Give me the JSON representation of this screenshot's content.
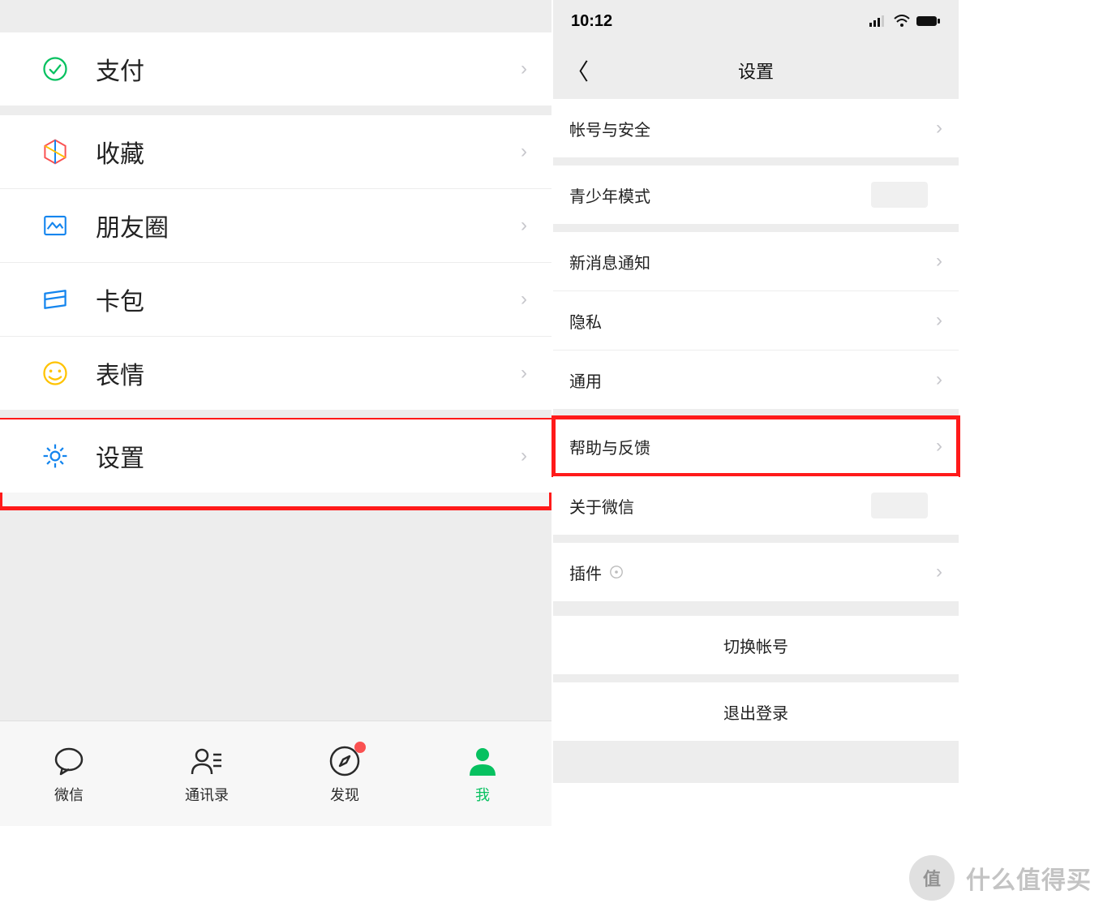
{
  "left": {
    "items": {
      "pay": {
        "label": "支付"
      },
      "favorites": {
        "label": "收藏"
      },
      "moments": {
        "label": "朋友圈"
      },
      "cards": {
        "label": "卡包"
      },
      "stickers": {
        "label": "表情"
      },
      "settings": {
        "label": "设置"
      }
    },
    "tabs": {
      "chats": {
        "label": "微信"
      },
      "contacts": {
        "label": "通讯录"
      },
      "discover": {
        "label": "发现"
      },
      "me": {
        "label": "我"
      }
    }
  },
  "right": {
    "status": {
      "time": "10:12"
    },
    "nav": {
      "title": "设置"
    },
    "items": {
      "account": {
        "label": "帐号与安全"
      },
      "youth": {
        "label": "青少年模式"
      },
      "notify": {
        "label": "新消息通知"
      },
      "privacy": {
        "label": "隐私"
      },
      "general": {
        "label": "通用"
      },
      "help": {
        "label": "帮助与反馈"
      },
      "about": {
        "label": "关于微信"
      },
      "plugins": {
        "label": "插件"
      }
    },
    "actions": {
      "switch": {
        "label": "切换帐号"
      },
      "logout": {
        "label": "退出登录"
      }
    }
  },
  "watermark": {
    "badge": "值",
    "text": "什么值得买"
  }
}
